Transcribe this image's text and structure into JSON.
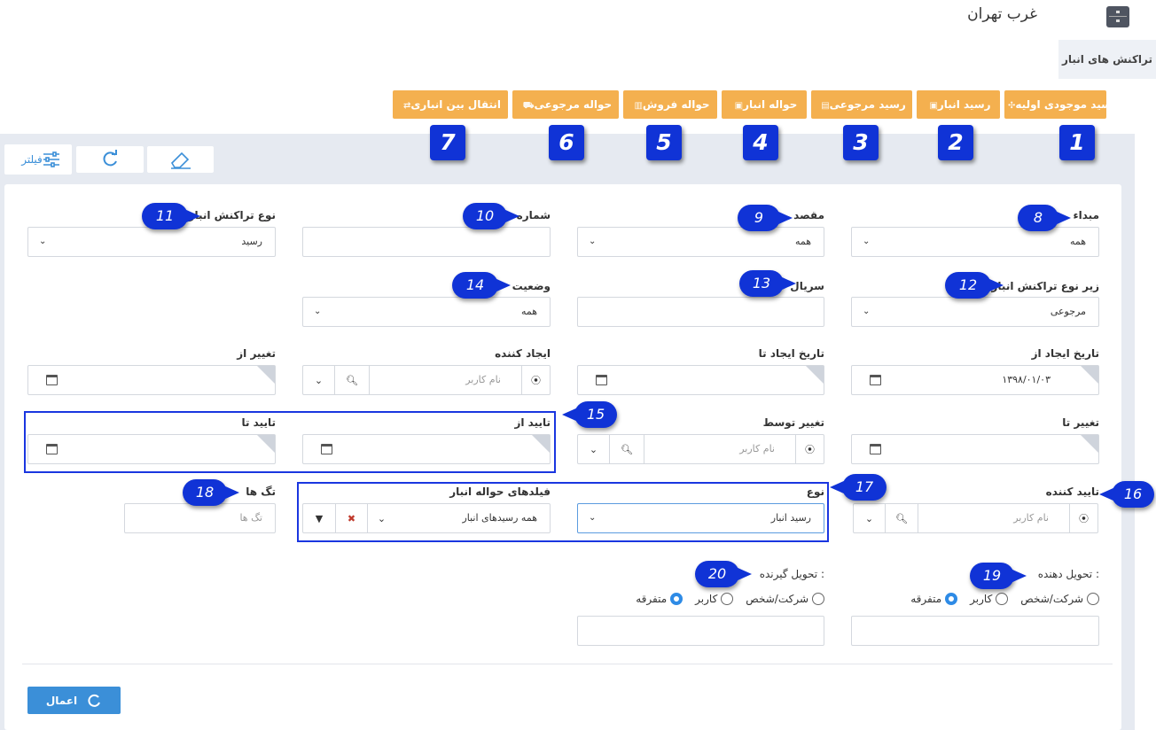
{
  "header": {
    "title": "غرب تهران",
    "tab_label": "تراکنش های انبار"
  },
  "transaction_buttons": [
    {
      "label": "رسید موجودی اولیه",
      "num": "1"
    },
    {
      "label": "رسید انبار",
      "num": "2"
    },
    {
      "label": "رسید مرجوعی",
      "num": "3"
    },
    {
      "label": "حواله انبار",
      "num": "4"
    },
    {
      "label": "حواله فروش",
      "num": "5"
    },
    {
      "label": "حواله مرجوعی",
      "num": "6"
    },
    {
      "label": "انتقال بین انباری",
      "num": "7"
    }
  ],
  "toolbar": {
    "filter_label": "فیلتر"
  },
  "filters": {
    "source": {
      "label": "مبداء",
      "value": "همه"
    },
    "destination": {
      "label": "مقصد",
      "value": "همه"
    },
    "number": {
      "label": "شماره",
      "value": ""
    },
    "tx_type": {
      "label": "نوع تراکنش انبار",
      "value": "رسید"
    },
    "sub_type": {
      "label": "زیر نوع تراکنش انبار",
      "value": "مرجوعی"
    },
    "serial": {
      "label": "سریال",
      "value": ""
    },
    "status": {
      "label": "وضعیت",
      "value": "همه"
    },
    "created_from": {
      "label": "تاریخ ایجاد از",
      "value": "۱۳۹۸/۰۱/۰۳"
    },
    "created_to": {
      "label": "تاریخ ایجاد تا",
      "value": ""
    },
    "creator": {
      "label": "ایجاد کننده",
      "placeholder": "نام کاربر"
    },
    "changed_from": {
      "label": "تغییر از",
      "value": ""
    },
    "changed_to": {
      "label": "تغییر تا",
      "value": ""
    },
    "changed_by": {
      "label": "تغییر توسط",
      "placeholder": "نام کاربر"
    },
    "approved_from": {
      "label": "تایید از",
      "value": ""
    },
    "approved_to": {
      "label": "تایید تا",
      "value": ""
    },
    "approver": {
      "label": "تایید کننده",
      "placeholder": "نام کاربر"
    },
    "kind": {
      "label": "نوع",
      "value": "رسید انبار"
    },
    "voucher_fields": {
      "label": "فیلدهای حواله انبار",
      "value": "همه رسیدهای انبار"
    },
    "tags": {
      "label": "تگ ها",
      "placeholder": "تگ ها"
    },
    "deliverer": {
      "label": "تحویل دهنده :",
      "options": [
        "شرکت/شخص",
        "کاربر",
        "متفرقه"
      ],
      "selected": "متفرقه"
    },
    "receiver": {
      "label": "تحویل گیرنده :",
      "options": [
        "شرکت/شخص",
        "کاربر",
        "متفرقه"
      ],
      "selected": "متفرقه"
    }
  },
  "callouts": [
    "8",
    "9",
    "10",
    "11",
    "12",
    "13",
    "14",
    "15",
    "16",
    "17",
    "18",
    "19",
    "20"
  ],
  "apply_label": "اعمال",
  "colors": {
    "accent": "#3b8fd8",
    "orange": "#f4b04f",
    "callout": "#1033d6"
  }
}
